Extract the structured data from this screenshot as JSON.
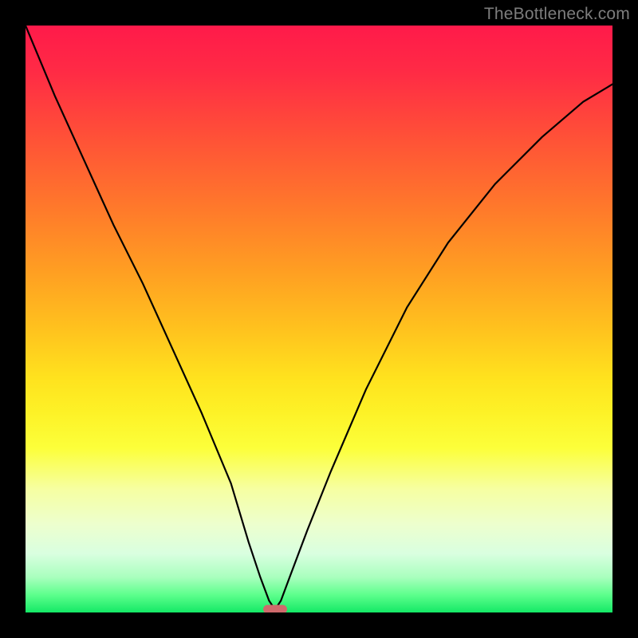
{
  "watermark": "TheBottleneck.com",
  "colors": {
    "frame": "#000000",
    "marker": "#cf6a6c",
    "curve": "#000000"
  },
  "chart_data": {
    "type": "line",
    "title": "",
    "xlabel": "",
    "ylabel": "",
    "xlim": [
      0,
      100
    ],
    "ylim": [
      0,
      100
    ],
    "x": [
      0,
      5,
      10,
      15,
      20,
      25,
      30,
      35,
      38,
      40,
      41.5,
      42.5,
      43.5,
      45,
      48,
      52,
      58,
      65,
      72,
      80,
      88,
      95,
      100
    ],
    "values": [
      100,
      88,
      77,
      66,
      56,
      45,
      34,
      22,
      12,
      6,
      2,
      0.5,
      2,
      6,
      14,
      24,
      38,
      52,
      63,
      73,
      81,
      87,
      90
    ],
    "minimum_x": 42.5,
    "marker": {
      "x": 42.5,
      "y": 0.5
    },
    "gradient_stops": [
      {
        "p": 0,
        "c": "#ff1a4a"
      },
      {
        "p": 50,
        "c": "#ffe21e"
      },
      {
        "p": 80,
        "c": "#f6ffa2"
      },
      {
        "p": 100,
        "c": "#14e866"
      }
    ]
  }
}
